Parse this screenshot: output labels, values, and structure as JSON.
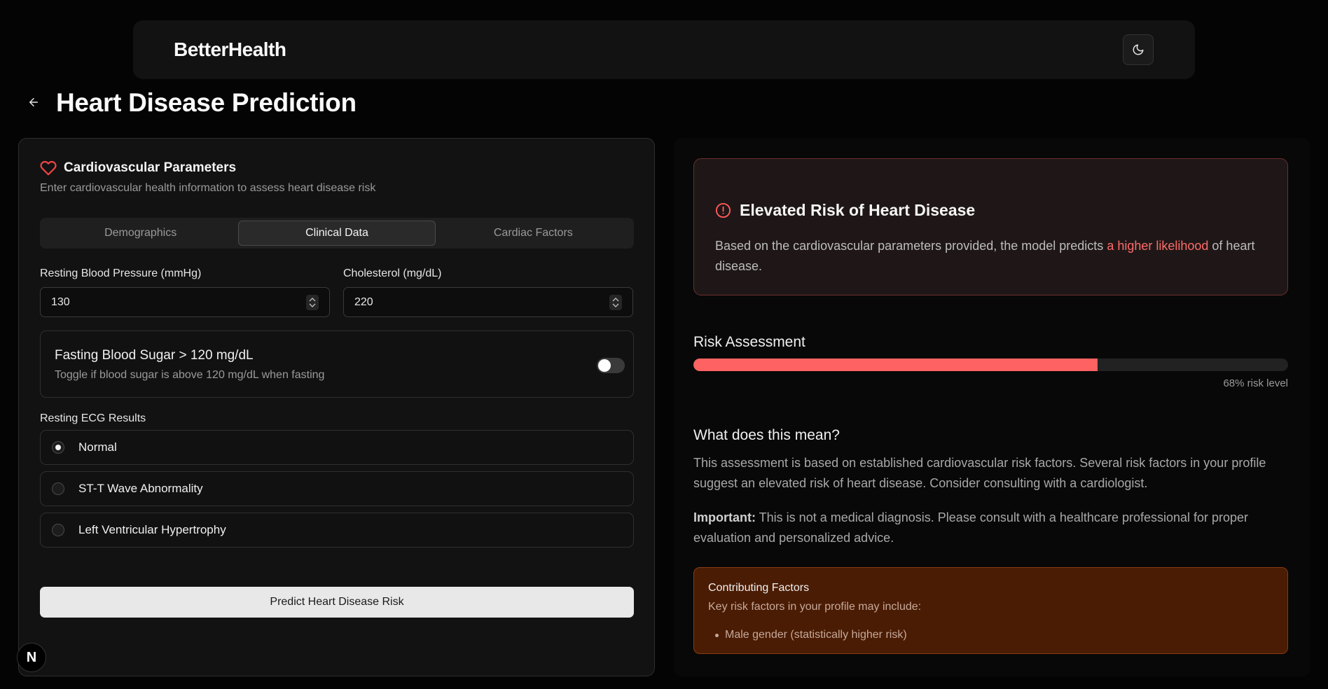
{
  "navbar": {
    "brand": "BetterHealth",
    "theme_icon": "moon-icon"
  },
  "page": {
    "title": "Heart Disease Prediction",
    "back_icon": "arrow-left-icon"
  },
  "form": {
    "icon": "heart-icon",
    "title": "Cardiovascular Parameters",
    "description": "Enter cardiovascular health information to assess heart disease risk",
    "tabs": [
      {
        "label": "Demographics",
        "active": false
      },
      {
        "label": "Clinical Data",
        "active": true
      },
      {
        "label": "Cardiac Factors",
        "active": false
      }
    ],
    "resting_bp": {
      "label": "Resting Blood Pressure (mmHg)",
      "value": "130"
    },
    "cholesterol": {
      "label": "Cholesterol (mg/dL)",
      "value": "220"
    },
    "fasting_sugar": {
      "title": "Fasting Blood Sugar > 120 mg/dL",
      "description": "Toggle if blood sugar is above 120 mg/dL when fasting",
      "checked": false
    },
    "ecg": {
      "label": "Resting ECG Results",
      "options": [
        {
          "label": "Normal",
          "selected": true
        },
        {
          "label": "ST-T Wave Abnormality",
          "selected": false
        },
        {
          "label": "Left Ventricular Hypertrophy",
          "selected": false
        }
      ]
    },
    "submit_label": "Predict Heart Disease Risk"
  },
  "result": {
    "alert_icon": "alert-circle-icon",
    "alert_title": "Elevated Risk of Heart Disease",
    "alert_body_pre": "Based on the cardiovascular parameters provided, the model predicts ",
    "alert_body_highlight": "a higher likelihood",
    "alert_body_post": " of heart disease.",
    "risk_title": "Risk Assessment",
    "risk_percent": 68,
    "risk_label": "68% risk level",
    "meaning_title": "What does this mean?",
    "meaning_body": "This assessment is based on established cardiovascular risk factors. Several risk factors in your profile suggest an elevated risk of heart disease. Consider consulting with a cardiologist.",
    "important_label": "Important:",
    "important_body": " This is not a medical diagnosis. Please consult with a healthcare professional for proper evaluation and personalized advice.",
    "factors_title": "Contributing Factors",
    "factors_sub": "Key risk factors in your profile may include:",
    "factors": [
      "Male gender (statistically higher risk)"
    ]
  },
  "dev_badge": "N",
  "colors": {
    "accent_red": "#ff6262",
    "heart_red": "#ef4444",
    "factors_bg": "#4a1c04"
  }
}
